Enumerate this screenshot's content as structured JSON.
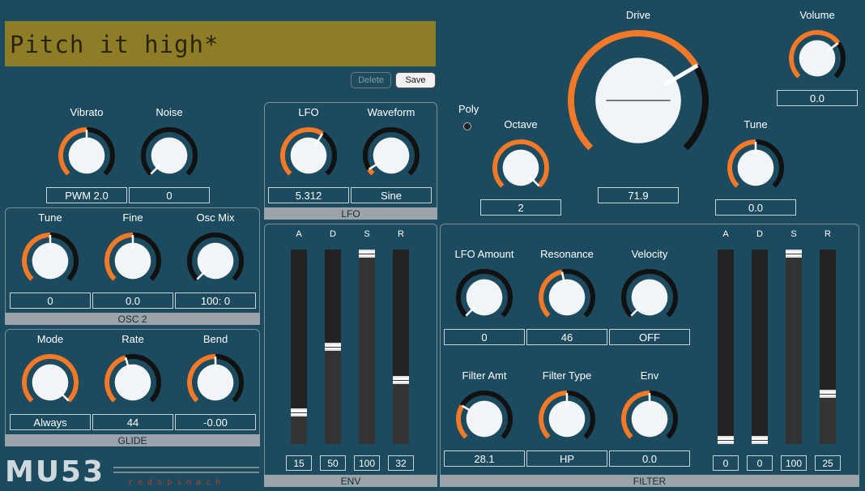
{
  "preset": {
    "name": "Pitch it high*",
    "delete_label": "Delete",
    "save_label": "Save"
  },
  "colors": {
    "accent": "#f07a2a",
    "background": "#1c4a5e",
    "lcd": "#8e7d27"
  },
  "top_left": {
    "vibrato": {
      "label": "Vibrato",
      "value": "PWM 2.0",
      "level": 0.5
    },
    "noise": {
      "label": "Noise",
      "value": "0",
      "level": 0.0
    }
  },
  "lfo": {
    "title": "LFO",
    "rate": {
      "label": "LFO",
      "value": "5.312",
      "level": 0.62
    },
    "waveform": {
      "label": "Waveform",
      "value": "Sine",
      "level": 0.05
    }
  },
  "osc2": {
    "title": "OSC 2",
    "tune": {
      "label": "Tune",
      "value": "0",
      "level": 0.5
    },
    "fine": {
      "label": "Fine",
      "value": "0.0",
      "level": 0.5
    },
    "oscmix": {
      "label": "Osc Mix",
      "value": "100: 0",
      "level": 0.0
    }
  },
  "glide": {
    "title": "GLIDE",
    "mode": {
      "label": "Mode",
      "value": "Always",
      "level": 1.0
    },
    "rate": {
      "label": "Rate",
      "value": "44",
      "level": 0.44
    },
    "bend": {
      "label": "Bend",
      "value": "-0.00",
      "level": 0.5
    }
  },
  "env": {
    "title": "ENV",
    "headers": [
      "A",
      "D",
      "S",
      "R"
    ],
    "values": [
      "15",
      "50",
      "100",
      "32"
    ],
    "levels": [
      0.15,
      0.5,
      1.0,
      0.32
    ]
  },
  "main": {
    "poly_label": "Poly",
    "drive": {
      "label": "Drive",
      "value": "71.9",
      "level": 0.72
    },
    "volume": {
      "label": "Volume",
      "value": "0.0",
      "level": 0.7
    },
    "octave": {
      "label": "Octave",
      "value": "2",
      "level": 1.0
    },
    "tune": {
      "label": "Tune",
      "value": "0.0",
      "level": 0.5
    }
  },
  "filter": {
    "title": "FILTER",
    "lfo_amount": {
      "label": "LFO Amount",
      "value": "0",
      "level": 0.0
    },
    "resonance": {
      "label": "Resonance",
      "value": "46",
      "level": 0.46
    },
    "velocity": {
      "label": "Velocity",
      "value": "OFF",
      "level": 0.0
    },
    "filter_amt": {
      "label": "Filter Amt",
      "value": "28.1",
      "level": 0.28
    },
    "filter_type": {
      "label": "Filter Type",
      "value": "HP",
      "level": 0.5
    },
    "env": {
      "label": "Env",
      "value": "0.0",
      "level": 0.5
    },
    "headers": [
      "A",
      "D",
      "S",
      "R"
    ],
    "values": [
      "0",
      "0",
      "100",
      "25"
    ],
    "levels": [
      0.0,
      0.0,
      1.0,
      0.25
    ]
  },
  "brand": {
    "logo": "MU53",
    "maker": "redspinach"
  }
}
